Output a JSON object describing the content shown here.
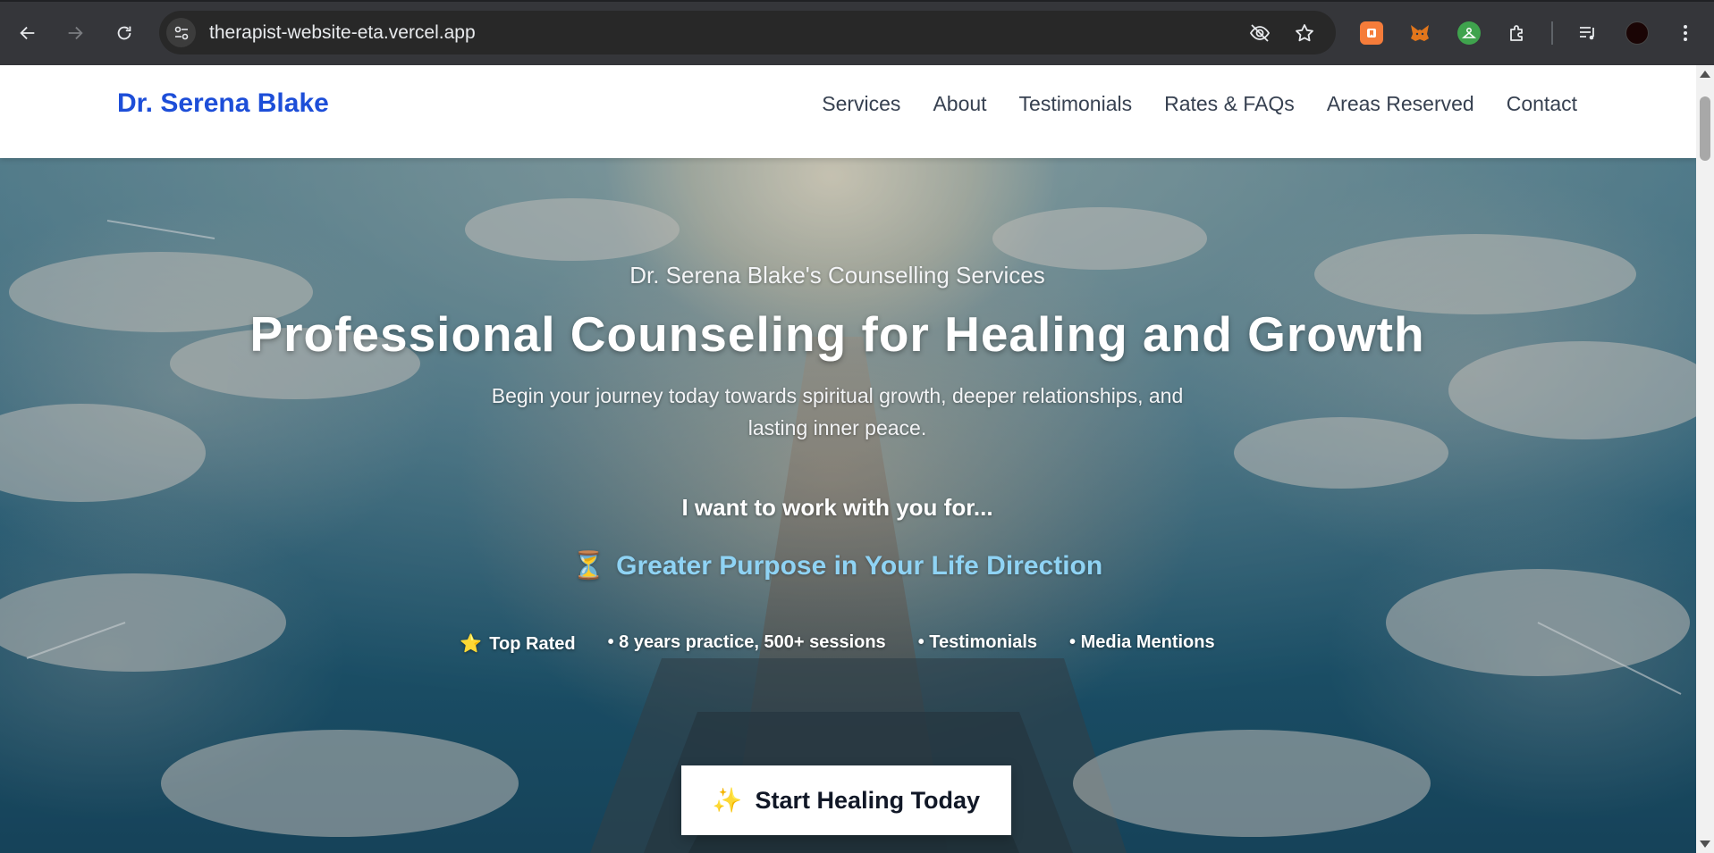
{
  "browser": {
    "url": "therapist-website-eta.vercel.app",
    "icons": [
      "back-icon",
      "forward-icon",
      "reload-icon",
      "site-info-icon",
      "eye-off-icon",
      "bookmark-star-icon",
      "extensions-puzzle-icon",
      "media-queue-icon",
      "menu-kebab-icon"
    ]
  },
  "header": {
    "brand": "Dr. Serena Blake",
    "nav": [
      "Services",
      "About",
      "Testimonials",
      "Rates & FAQs",
      "Areas Reserved",
      "Contact"
    ]
  },
  "hero": {
    "eyebrow": "Dr. Serena Blake's Counselling Services",
    "headline": "Professional Counseling for Healing and Growth",
    "subhead": "Begin your journey today towards spiritual growth, deeper relationships, and lasting inner peace.",
    "want_label": "I want to work with you for...",
    "rotating_icon": "⏳",
    "rotating_text": "Greater Purpose in Your Life Direction",
    "badges": {
      "top_rated_icon": "⭐",
      "top_rated": "Top Rated",
      "experience": "• 8 years practice, 500+ sessions",
      "testimonials": "• Testimonials",
      "media": "• Media Mentions"
    },
    "cta_icon": "✨",
    "cta_label": "Start Healing Today"
  },
  "colors": {
    "brand": "#1d4ed8",
    "rotating_text": "#8fd3f4",
    "chrome_bg": "#35363a"
  }
}
